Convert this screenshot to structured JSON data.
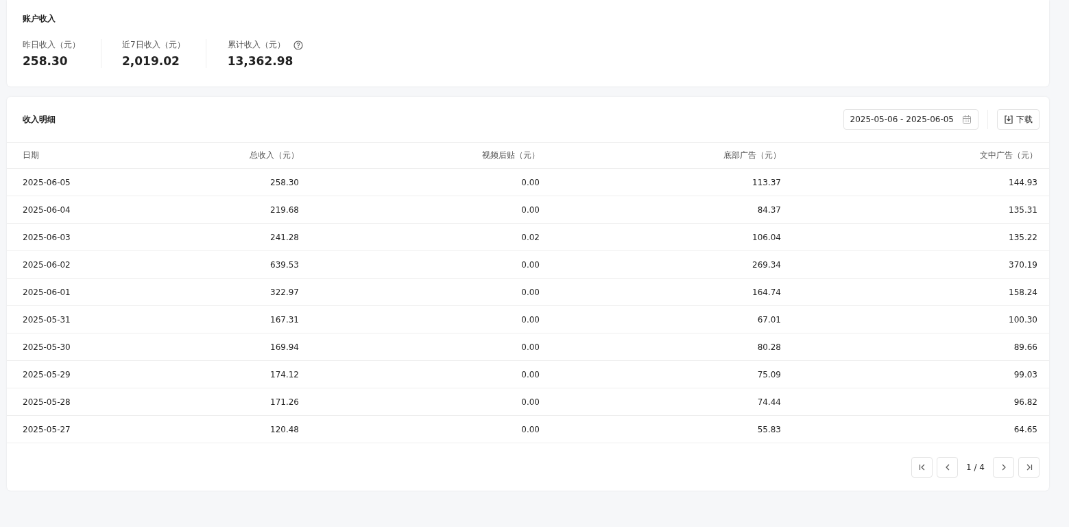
{
  "account_income": {
    "title": "账户收入",
    "stats": [
      {
        "label": "昨日收入（元）",
        "value": "258.30"
      },
      {
        "label": "近7日收入（元）",
        "value": "2,019.02"
      },
      {
        "label": "累计收入（元）",
        "value": "13,362.98",
        "help": true
      }
    ]
  },
  "income_details": {
    "title": "收入明细",
    "date_range": "2025-05-06 - 2025-06-05",
    "download_button": "下载",
    "table": {
      "columns": [
        "日期",
        "总收入（元）",
        "视频后贴（元）",
        "底部广告（元）",
        "文中广告（元）"
      ],
      "rows": [
        [
          "2025-06-05",
          "258.30",
          "0.00",
          "113.37",
          "144.93"
        ],
        [
          "2025-06-04",
          "219.68",
          "0.00",
          "84.37",
          "135.31"
        ],
        [
          "2025-06-03",
          "241.28",
          "0.02",
          "106.04",
          "135.22"
        ],
        [
          "2025-06-02",
          "639.53",
          "0.00",
          "269.34",
          "370.19"
        ],
        [
          "2025-06-01",
          "322.97",
          "0.00",
          "164.74",
          "158.24"
        ],
        [
          "2025-05-31",
          "167.31",
          "0.00",
          "67.01",
          "100.30"
        ],
        [
          "2025-05-30",
          "169.94",
          "0.00",
          "80.28",
          "89.66"
        ],
        [
          "2025-05-29",
          "174.12",
          "0.00",
          "75.09",
          "99.03"
        ],
        [
          "2025-05-28",
          "171.26",
          "0.00",
          "74.44",
          "96.82"
        ],
        [
          "2025-05-27",
          "120.48",
          "0.00",
          "55.83",
          "64.65"
        ]
      ]
    },
    "pagination": {
      "page_indicator": "1 / 4"
    }
  }
}
